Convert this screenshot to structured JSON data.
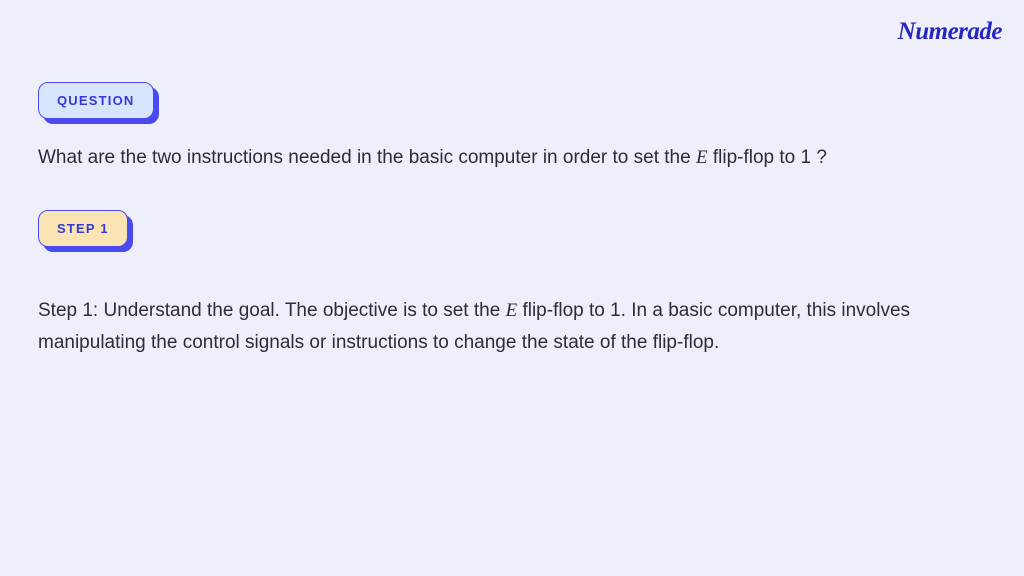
{
  "brand": "Numerade",
  "badges": {
    "question": "QUESTION",
    "step1": "STEP 1"
  },
  "question": {
    "pre": "What are the two instructions needed in the basic computer in order to set the ",
    "var": "E",
    "post": " flip-flop to 1 ?"
  },
  "step1_text": {
    "pre": "Step 1: Understand the goal. The objective is to set the ",
    "var": "E",
    "post": " flip-flop to 1. In a basic computer, this involves manipulating the control signals or instructions to change the state of the flip-flop."
  }
}
